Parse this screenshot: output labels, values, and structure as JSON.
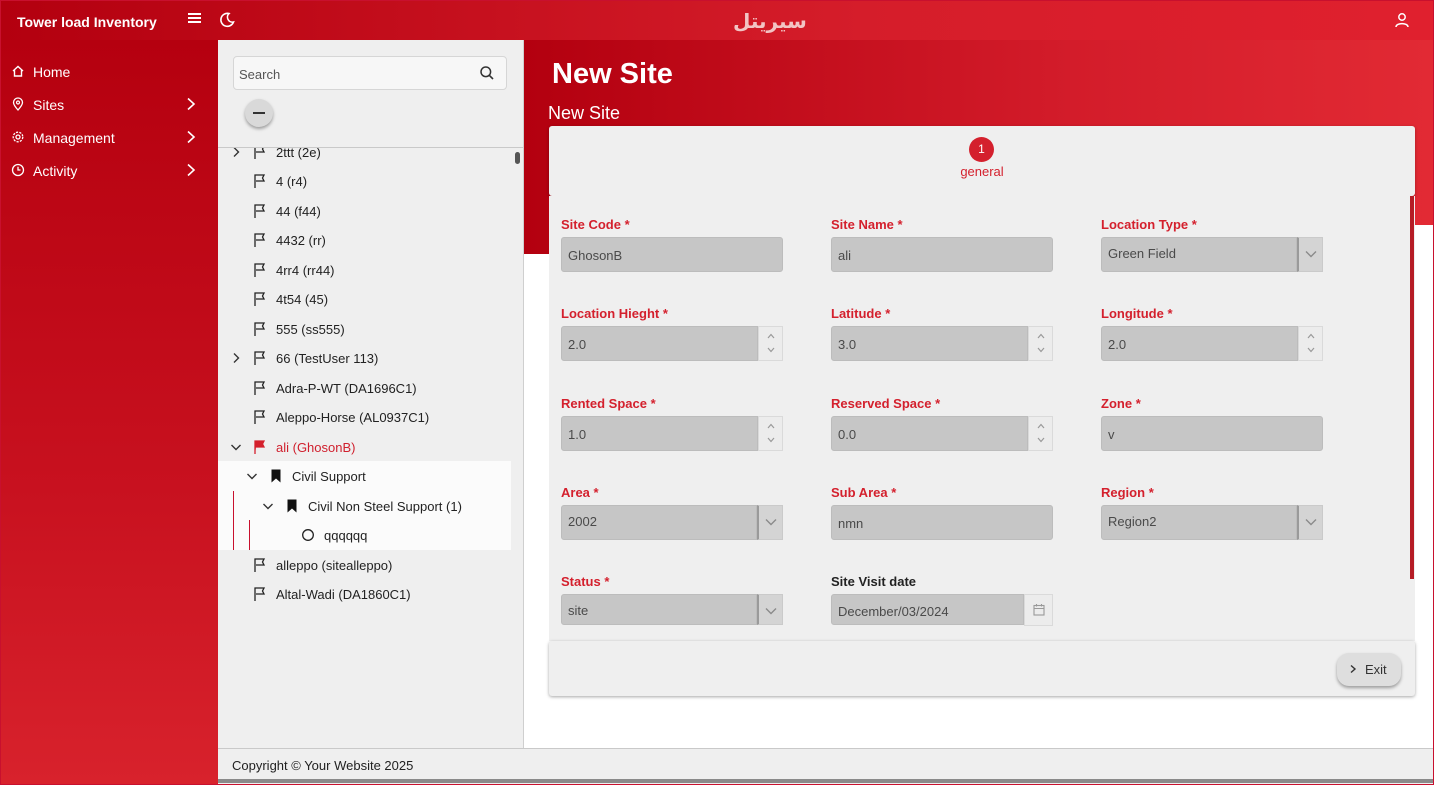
{
  "app": {
    "title": "Tower load Inventory",
    "logo_text": "سيريتل"
  },
  "sidebar": {
    "items": [
      {
        "label": "Home",
        "icon": "home-icon"
      },
      {
        "label": "Sites",
        "icon": "location-pin-icon"
      },
      {
        "label": "Management",
        "icon": "gear-icon"
      },
      {
        "label": "Activity",
        "icon": "clock-icon"
      }
    ]
  },
  "tree": {
    "search_placeholder": "Search",
    "items": [
      {
        "label": "2ttt (2e)",
        "expandable": true
      },
      {
        "label": "4 (r4)"
      },
      {
        "label": "44 (f44)"
      },
      {
        "label": "4432 (rr)"
      },
      {
        "label": "4rr4 (rr44)"
      },
      {
        "label": "4t54 (45)"
      },
      {
        "label": "555 (ss555)"
      },
      {
        "label": "66 (TestUser 113)",
        "expandable": true
      },
      {
        "label": "Adra-P-WT (DA1696C1)"
      },
      {
        "label": "Aleppo-Horse (AL0937C1)"
      },
      {
        "label": "ali (GhosonB)",
        "expanded": true,
        "selected": true
      },
      {
        "label": "Civil Support",
        "expanded": true
      },
      {
        "label": "Civil Non Steel Support (1)",
        "expanded": true
      },
      {
        "label": "qqqqqq"
      },
      {
        "label": "alleppo (sitealleppo)"
      },
      {
        "label": "Altal-Wadi (DA1860C1)"
      }
    ]
  },
  "page": {
    "title": "New Site",
    "subtitle": "New Site"
  },
  "stepper": {
    "number": "1",
    "label": "general"
  },
  "form": {
    "site_code": {
      "label": "Site Code",
      "value": "GhosonB"
    },
    "site_name": {
      "label": "Site Name",
      "value": "ali"
    },
    "location_type": {
      "label": "Location Type",
      "value": "Green Field"
    },
    "location_height": {
      "label": "Location Hieght",
      "value": "2.0"
    },
    "latitude": {
      "label": "Latitude",
      "value": "3.0"
    },
    "longitude": {
      "label": "Longitude",
      "value": "2.0"
    },
    "rented_space": {
      "label": "Rented Space",
      "value": "1.0"
    },
    "reserved_space": {
      "label": "Reserved Space",
      "value": "0.0"
    },
    "zone": {
      "label": "Zone",
      "value": "v"
    },
    "area": {
      "label": "Area",
      "value": "2002"
    },
    "sub_area": {
      "label": "Sub Area",
      "value": "nmn"
    },
    "region": {
      "label": "Region",
      "value": "Region2"
    },
    "status": {
      "label": "Status",
      "value": "site"
    },
    "site_visit_date": {
      "label": "Site Visit date",
      "value": "December/03/2024"
    },
    "required_mark": "*"
  },
  "actions": {
    "exit_label": "Exit"
  },
  "footer": {
    "text": "Copyright © Your Website 2025"
  },
  "colors": {
    "brand_red": "#c8102e",
    "accent_red": "#d4202d",
    "input_bg": "#c6c6c6"
  }
}
